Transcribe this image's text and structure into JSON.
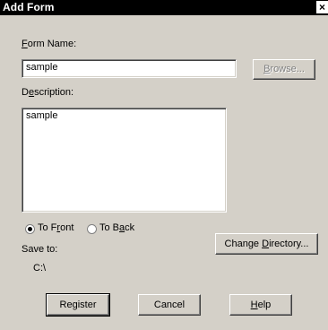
{
  "window": {
    "title": "Add Form",
    "close_glyph": "×"
  },
  "form_name": {
    "label_prefix": "",
    "label_accel": "F",
    "label_rest": "orm Name:",
    "value": "sample"
  },
  "browse_button": {
    "prefix": "",
    "accel": "B",
    "rest": "rowse..."
  },
  "description": {
    "label_prefix": "D",
    "label_accel": "e",
    "label_rest": "scription:",
    "value": "sample"
  },
  "radios": [
    {
      "prefix": "To F",
      "accel": "r",
      "rest": "ont",
      "selected": true
    },
    {
      "prefix": "To B",
      "accel": "a",
      "rest": "ck",
      "selected": false
    }
  ],
  "save_to": {
    "label": "Save to:",
    "path": "C:\\"
  },
  "change_directory_button": {
    "prefix": "Change ",
    "accel": "D",
    "rest": "irectory..."
  },
  "buttons": {
    "register": "Register",
    "cancel": "Cancel",
    "help_accel": "H",
    "help_rest": "elp"
  }
}
